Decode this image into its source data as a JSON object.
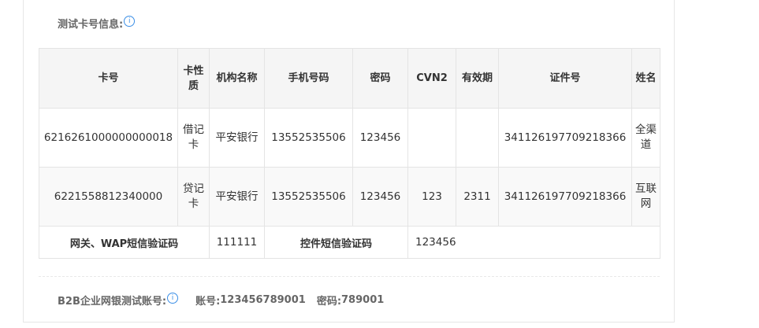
{
  "section": {
    "title": "测试卡号信息:"
  },
  "table": {
    "headers": [
      "卡号",
      "卡性质",
      "机构名称",
      "手机号码",
      "密码",
      "CVN2",
      "有效期",
      "证件号",
      "姓名"
    ],
    "rows": [
      [
        "6216261000000000018",
        "借记卡",
        "平安银行",
        "13552535506",
        "123456",
        "",
        "",
        "341126197709218366",
        "全渠道"
      ],
      [
        "6221558812340000",
        "贷记卡",
        "平安银行",
        "13552535506",
        "123456",
        "123",
        "2311",
        "341126197709218366",
        "互联网"
      ]
    ],
    "footer": {
      "gateway_label": "网关、WAP短信验证码",
      "gateway_code": "111111",
      "control_label": "控件短信验证码",
      "control_code": "123456"
    }
  },
  "b2b": {
    "title": "B2B企业网银测试账号:",
    "account_label": "账号:",
    "account_value": "123456789001",
    "password_label": "密码:",
    "password_value": "789001"
  },
  "icons": {
    "info": "info-icon"
  },
  "colors": {
    "accent": "#3a8ee6",
    "header_bg": "#f5f5f5",
    "border": "#e4e4e4"
  }
}
